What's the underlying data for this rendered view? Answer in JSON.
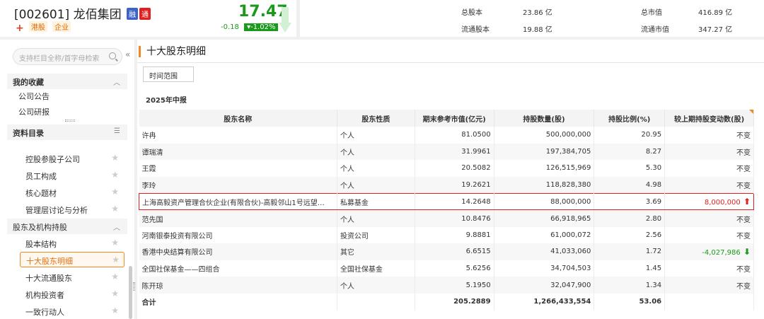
{
  "stock": {
    "code_name": "[002601] 龙佰集团",
    "badge_margin": "融",
    "badge_through": "通",
    "plus": "+",
    "tags": [
      "港股",
      "企业"
    ],
    "price": "17.47",
    "change": "-0.18",
    "change_pct": "▾-1.02%",
    "color_down": "#1a9a1a",
    "color_up": "#e02020"
  },
  "stats": {
    "total_shares_label": "总股本",
    "total_shares": "23.86 亿",
    "total_mcap_label": "总市值",
    "total_mcap": "416.89 亿",
    "float_shares_label": "流通股本",
    "float_shares": "19.88 亿",
    "float_mcap_label": "流通市值",
    "float_mcap": "347.27 亿"
  },
  "sidebar": {
    "search_placeholder": "支持栏目全称/首字母检索",
    "collapse": "«",
    "favorites": {
      "label": "我的收藏",
      "items": [
        "公司公告",
        "公司研报"
      ]
    },
    "catalog": {
      "label": "资料目录"
    },
    "items": [
      "控股参股子公司",
      "员工构成",
      "核心题材",
      "管理层讨论与分析"
    ],
    "group": {
      "label": "股东及机构持股",
      "items": [
        "股本结构",
        "十大股东明细",
        "十大流通股东",
        "机构投资者",
        "一致行动人"
      ]
    }
  },
  "main": {
    "title": "十大股东明细",
    "time_range": "时间范围",
    "period": "2025年中报",
    "columns": [
      "股东名称",
      "股东性质",
      "期末参考市值(亿元)",
      "持股数量(股)",
      "持股比例(%)",
      "较上期持股变动数(股)"
    ],
    "rows": [
      [
        "许冉",
        "个人",
        "81.0500",
        "500,000,000",
        "20.95",
        "不变"
      ],
      [
        "谭瑞清",
        "个人",
        "31.9961",
        "197,384,705",
        "8.27",
        "不变"
      ],
      [
        "王霞",
        "个人",
        "20.5082",
        "126,515,969",
        "5.30",
        "不变"
      ],
      [
        "李玲",
        "个人",
        "19.2621",
        "118,828,380",
        "4.98",
        "不变"
      ],
      [
        "上海高毅资产管理合伙企业(有限合伙)-高毅邻山1号远望…",
        "私募基金",
        "14.2648",
        "88,000,000",
        "3.69",
        "8,000,000"
      ],
      [
        "范先国",
        "个人",
        "10.8476",
        "66,918,965",
        "2.80",
        "不变"
      ],
      [
        "河南银泰投资有限公司",
        "投资公司",
        "9.8881",
        "61,000,072",
        "2.56",
        "不变"
      ],
      [
        "香港中央结算有限公司",
        "其它",
        "6.6515",
        "41,033,060",
        "1.72",
        "-4,027,986"
      ],
      [
        "全国社保基金——四组合",
        "全国社保基金",
        "5.6256",
        "34,704,503",
        "1.45",
        "不变"
      ],
      [
        "陈开琼",
        "个人",
        "5.1950",
        "32,047,900",
        "1.34",
        "不变"
      ]
    ],
    "total": [
      "合计",
      "",
      "205.2889",
      "1,266,433,554",
      "53.06",
      ""
    ]
  }
}
